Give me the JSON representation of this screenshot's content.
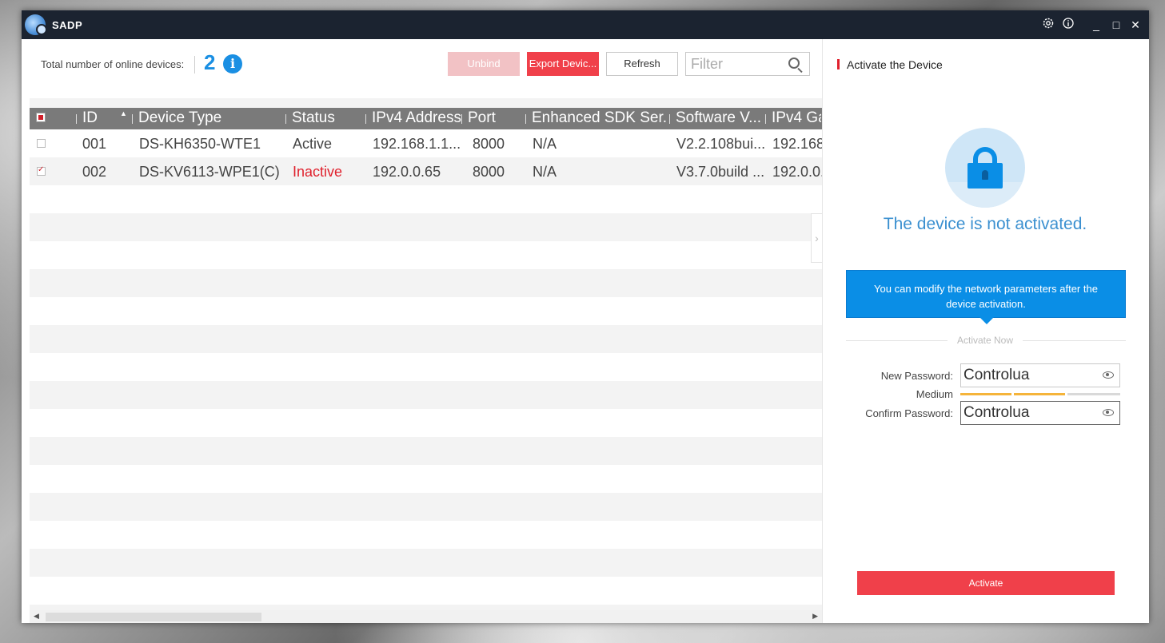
{
  "app": {
    "title": "SADP",
    "window_controls": {
      "settings_icon": "gear-icon",
      "info_icon": "info-icon",
      "minimize": "_",
      "maximize": "□",
      "close": "✕"
    }
  },
  "toolbar": {
    "total_label": "Total number of online devices:",
    "total_count": "2",
    "info_glyph": "i",
    "unbind_label": "Unbind",
    "export_label": "Export Devic...",
    "refresh_label": "Refresh",
    "filter_placeholder": "Filter",
    "filter_value": ""
  },
  "table": {
    "columns": [
      "ID",
      "Device Type",
      "Status",
      "IPv4 Address",
      "Port",
      "Enhanced SDK Ser...",
      "Software V...",
      "IPv4 Ga"
    ],
    "rows": [
      {
        "id": "001",
        "device_type": "DS-KH6350-WTE1",
        "status": "Active",
        "ipv4": "192.168.1.1...",
        "port": "8000",
        "sdk": "N/A",
        "software": "V2.2.108bui...",
        "gateway": "192.168",
        "checked": false
      },
      {
        "id": "002",
        "device_type": "DS-KV6113-WPE1(C)",
        "status": "Inactive",
        "ipv4": "192.0.0.65",
        "port": "8000",
        "sdk": "N/A",
        "software": "V3.7.0build ...",
        "gateway": "192.0.0.",
        "checked": true
      }
    ]
  },
  "panel": {
    "title": "Activate the Device",
    "message": "The device is not activated.",
    "tooltip": "You can modify the network parameters after the device activation.",
    "activate_now": "Activate Now",
    "new_password_label": "New Password:",
    "new_password_value": "Controlua",
    "strength_label": "Medium",
    "strength_level": 2,
    "strength_max": 3,
    "confirm_password_label": "Confirm Password:",
    "confirm_password_value": "Controlua",
    "activate_label": "Activate"
  },
  "colors": {
    "accent_red": "#f0404a",
    "accent_blue": "#0a8ee6",
    "titlebar": "#1b2330",
    "strength_on": "#f5b43a"
  }
}
